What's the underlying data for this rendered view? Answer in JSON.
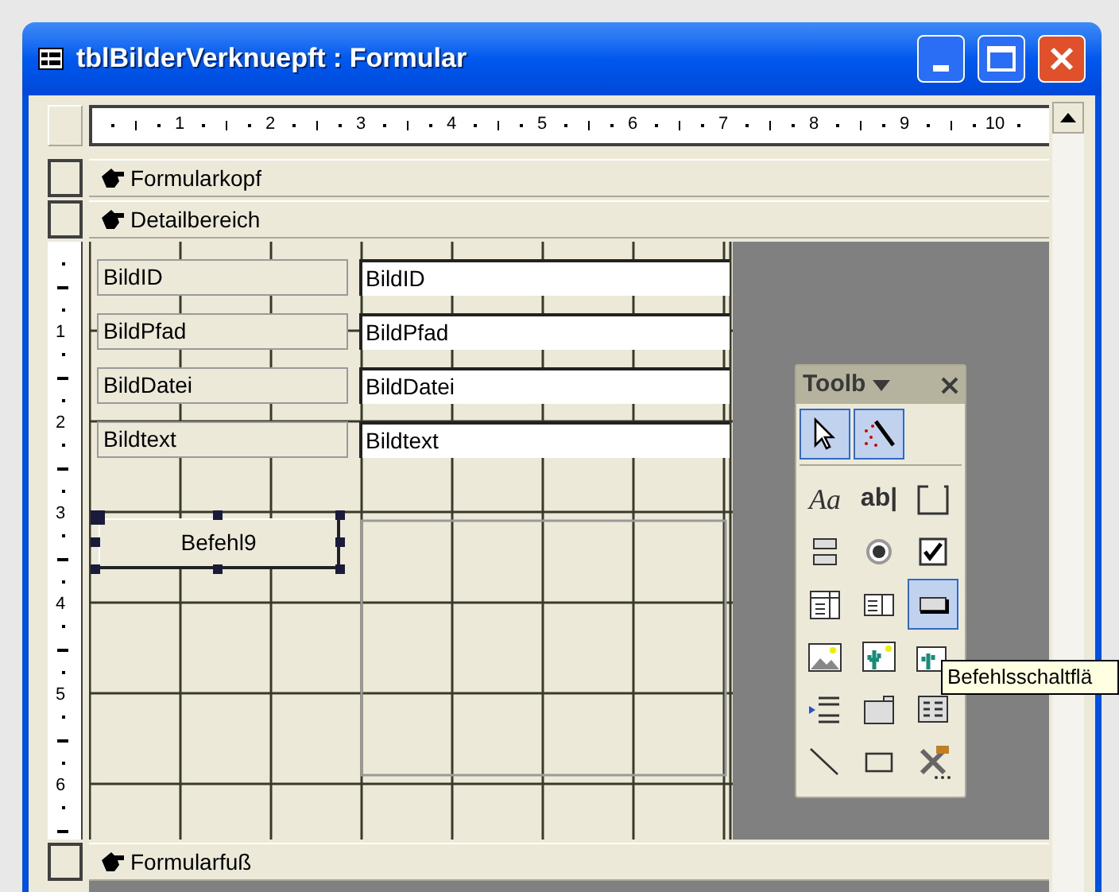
{
  "window": {
    "title": "tblBilderVerknuepft : Formular"
  },
  "ruler": {
    "marks": [
      "1",
      "2",
      "3",
      "4",
      "5",
      "6",
      "7",
      "8",
      "9",
      "10"
    ]
  },
  "vertical_ruler": {
    "marks": [
      "1",
      "2",
      "3",
      "4",
      "5",
      "6"
    ]
  },
  "sections": [
    {
      "label": "Formularkopf"
    },
    {
      "label": "Detailbereich"
    }
  ],
  "controls": [
    {
      "kind": "field",
      "label": "BildID",
      "value": "BildID"
    },
    {
      "kind": "field",
      "label": "BildPfad",
      "value": "BildPfad"
    },
    {
      "kind": "field",
      "label": "BildDatei",
      "value": "BildDatei"
    },
    {
      "kind": "field",
      "label": "Bildtext",
      "value": "Bildtext"
    },
    {
      "kind": "button",
      "label": "Befehl9",
      "selected": true
    }
  ],
  "footer_section": {
    "label": "Formularfuß"
  },
  "toolbox": {
    "title": "Toolb",
    "tools": [
      {
        "kind": "pointer",
        "selected": true
      },
      {
        "kind": "wizard",
        "selected": true
      },
      {
        "kind": "label",
        "glyph": "Aa",
        "selected": false
      },
      {
        "kind": "textbox",
        "glyph": "ab|",
        "selected": false
      },
      {
        "kind": "optiongroup",
        "selected": false
      },
      {
        "kind": "toggle",
        "selected": false
      },
      {
        "kind": "radio",
        "selected": false
      },
      {
        "kind": "checkbox",
        "selected": false
      },
      {
        "kind": "combobox",
        "selected": false
      },
      {
        "kind": "listbox",
        "selected": false
      },
      {
        "kind": "commandbutton",
        "selected": true
      },
      {
        "kind": "image",
        "selected": false
      },
      {
        "kind": "unboundobject",
        "selected": false
      },
      {
        "kind": "boundobject",
        "selected": false
      },
      {
        "kind": "pagebreak",
        "selected": false
      },
      {
        "kind": "tabcontrol",
        "selected": false
      },
      {
        "kind": "subform",
        "selected": false
      },
      {
        "kind": "line",
        "selected": false
      },
      {
        "kind": "rectangle",
        "selected": false
      },
      {
        "kind": "moretools",
        "selected": false
      }
    ]
  },
  "tooltip": {
    "text": "Befehlsschaltflä"
  }
}
